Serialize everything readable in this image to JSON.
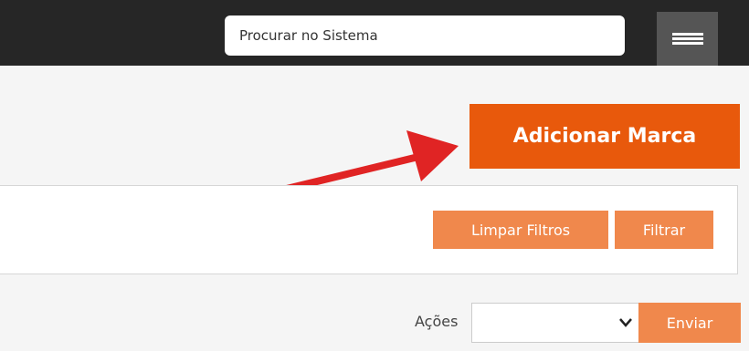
{
  "header": {
    "search": {
      "placeholder": "Procurar no Sistema",
      "value": ""
    },
    "menu_icon": "hamburger-icon"
  },
  "toolbar": {
    "add_brand_label": "Adicionar Marca"
  },
  "annotation": {
    "arrow_color": "#e02424"
  },
  "filters": {
    "clear_label": "Limpar Filtros",
    "filter_label": "Filtrar"
  },
  "bulk_actions": {
    "label": "Ações",
    "selected_option": "",
    "send_label": "Enviar"
  },
  "colors": {
    "topbar": "#262626",
    "accent": "#e8590c",
    "accent_light": "#f0884c",
    "background": "#f5f5f5"
  }
}
